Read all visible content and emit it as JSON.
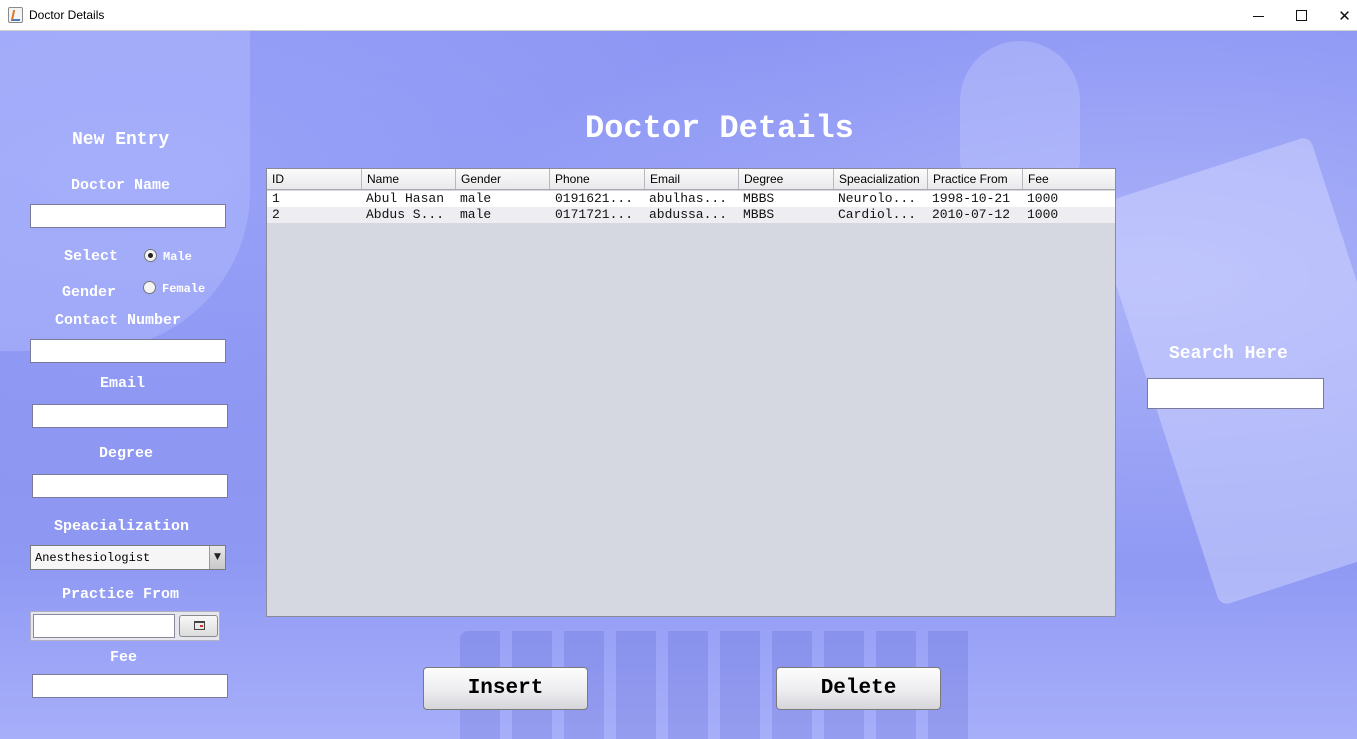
{
  "window": {
    "title": "Doctor Details",
    "controls": {
      "minimize": "minimize",
      "maximize": "maximize",
      "close": "✕"
    }
  },
  "form": {
    "heading": "New Entry",
    "doctor_name_label": "Doctor Name",
    "doctor_name_value": "",
    "gender_label_line1": "Select",
    "gender_label_line2": "Gender",
    "gender_options": [
      {
        "label": "Male",
        "selected": true
      },
      {
        "label": "Female",
        "selected": false
      }
    ],
    "contact_label": "Contact Number",
    "contact_value": "",
    "email_label": "Email",
    "email_value": "",
    "degree_label": "Degree",
    "degree_value": "",
    "specialization_label": "Speacialization",
    "specialization_selected": "Anesthesiologist",
    "specialization_arrow": "▼",
    "practice_from_label": "Practice From",
    "practice_from_value": "",
    "fee_label": "Fee",
    "fee_value": ""
  },
  "main": {
    "title": "Doctor Details"
  },
  "table": {
    "columns": [
      "ID",
      "Name",
      "Gender",
      "Phone",
      "Email",
      "Degree",
      "Speacialization",
      "Practice From",
      "Fee"
    ],
    "rows": [
      [
        "1",
        "Abul Hasan",
        "male",
        "0191621...",
        "abulhas...",
        "MBBS",
        "Neurolo...",
        "1998-10-21",
        "1000"
      ],
      [
        "2",
        "Abdus S...",
        "male",
        "0171721...",
        "abdussa...",
        "MBBS",
        "Cardiol...",
        "2010-07-12",
        "1000"
      ]
    ]
  },
  "search": {
    "label": "Search Here",
    "value": ""
  },
  "actions": {
    "insert_label": "Insert",
    "delete_label": "Delete"
  }
}
